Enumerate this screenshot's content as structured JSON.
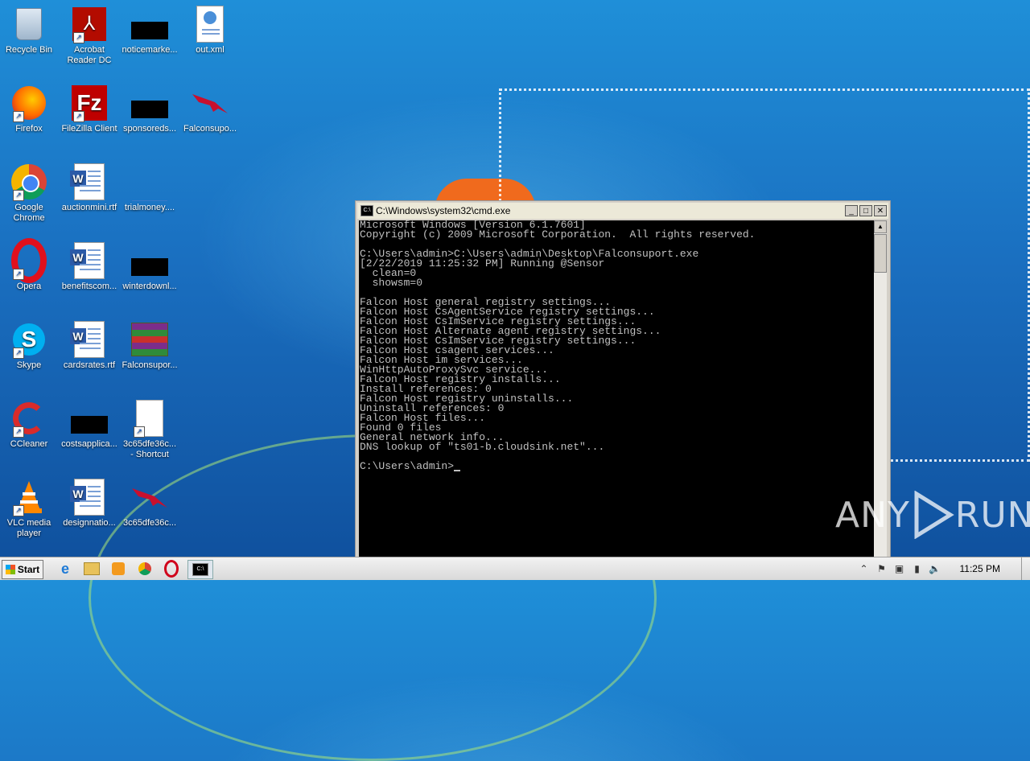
{
  "desktop": {
    "icons": [
      {
        "label": "Recycle Bin",
        "icon": "recycle-bin-icon"
      },
      {
        "label": "Acrobat\nReader DC",
        "icon": "acrobat-reader-icon"
      },
      {
        "label": "noticemarke...",
        "icon": "redacted-file-icon"
      },
      {
        "label": "out.xml",
        "icon": "xml-file-icon"
      },
      {
        "label": "Firefox",
        "icon": "firefox-icon"
      },
      {
        "label": "FileZilla Client",
        "icon": "filezilla-icon"
      },
      {
        "label": "sponsoreds...",
        "icon": "redacted-file-icon"
      },
      {
        "label": "Falconsupo...",
        "icon": "falcon-bird-icon"
      },
      {
        "label": "Google\nChrome",
        "icon": "chrome-icon"
      },
      {
        "label": "auctionmini.rtf",
        "icon": "word-doc-icon"
      },
      {
        "label": "trialmoney....",
        "icon": "blank-file-icon"
      },
      {
        "label": "Opera",
        "icon": "opera-icon"
      },
      {
        "label": "benefitscom...",
        "icon": "word-doc-icon"
      },
      {
        "label": "winterdownl...",
        "icon": "redacted-file-icon"
      },
      {
        "label": "Skype",
        "icon": "skype-icon"
      },
      {
        "label": "cardsrates.rtf",
        "icon": "word-doc-icon"
      },
      {
        "label": "Falconsupor...",
        "icon": "winrar-icon"
      },
      {
        "label": "CCleaner",
        "icon": "ccleaner-icon"
      },
      {
        "label": "costsapplica...",
        "icon": "redacted-file-icon"
      },
      {
        "label": "3c65dfe36c...\n- Shortcut",
        "icon": "shortcut-file-icon"
      },
      {
        "label": "VLC media\nplayer",
        "icon": "vlc-icon"
      },
      {
        "label": "designnatio...",
        "icon": "word-doc-icon"
      },
      {
        "label": "3c65dfe36c...",
        "icon": "falcon-bird-icon"
      }
    ]
  },
  "cmd_window": {
    "title": "C:\\Windows\\system32\\cmd.exe",
    "lines": [
      "Microsoft Windows [Version 6.1.7601]",
      "Copyright (c) 2009 Microsoft Corporation.  All rights reserved.",
      "",
      "C:\\Users\\admin>C:\\Users\\admin\\Desktop\\Falconsuport.exe",
      "[2/22/2019 11:25:32 PM] Running @Sensor",
      "  clean=0",
      "  showsm=0",
      "",
      "Falcon Host general registry settings...",
      "Falcon Host CsAgentService registry settings...",
      "Falcon Host CsImService registry settings...",
      "Falcon Host Alternate agent registry settings...",
      "Falcon Host CsImService registry settings...",
      "Falcon Host csagent services...",
      "Falcon Host im services...",
      "WinHttpAutoProxySvc service...",
      "Falcon Host registry installs...",
      "Install references: 0",
      "Falcon Host registry uninstalls...",
      "Uninstall references: 0",
      "Falcon Host files...",
      "Found 0 files",
      "General network info...",
      "DNS lookup of \"ts01-b.cloudsink.net\"...",
      ""
    ],
    "prompt": "C:\\Users\\admin>"
  },
  "watermark": {
    "text_left": "ANY",
    "text_right": "RUN"
  },
  "taskbar": {
    "start_label": "Start",
    "apps": [
      "ie-icon",
      "explorer-icon",
      "media-player-icon",
      "chrome-icon",
      "opera-icon",
      "cmd-icon"
    ],
    "clock": "11:25 PM"
  }
}
